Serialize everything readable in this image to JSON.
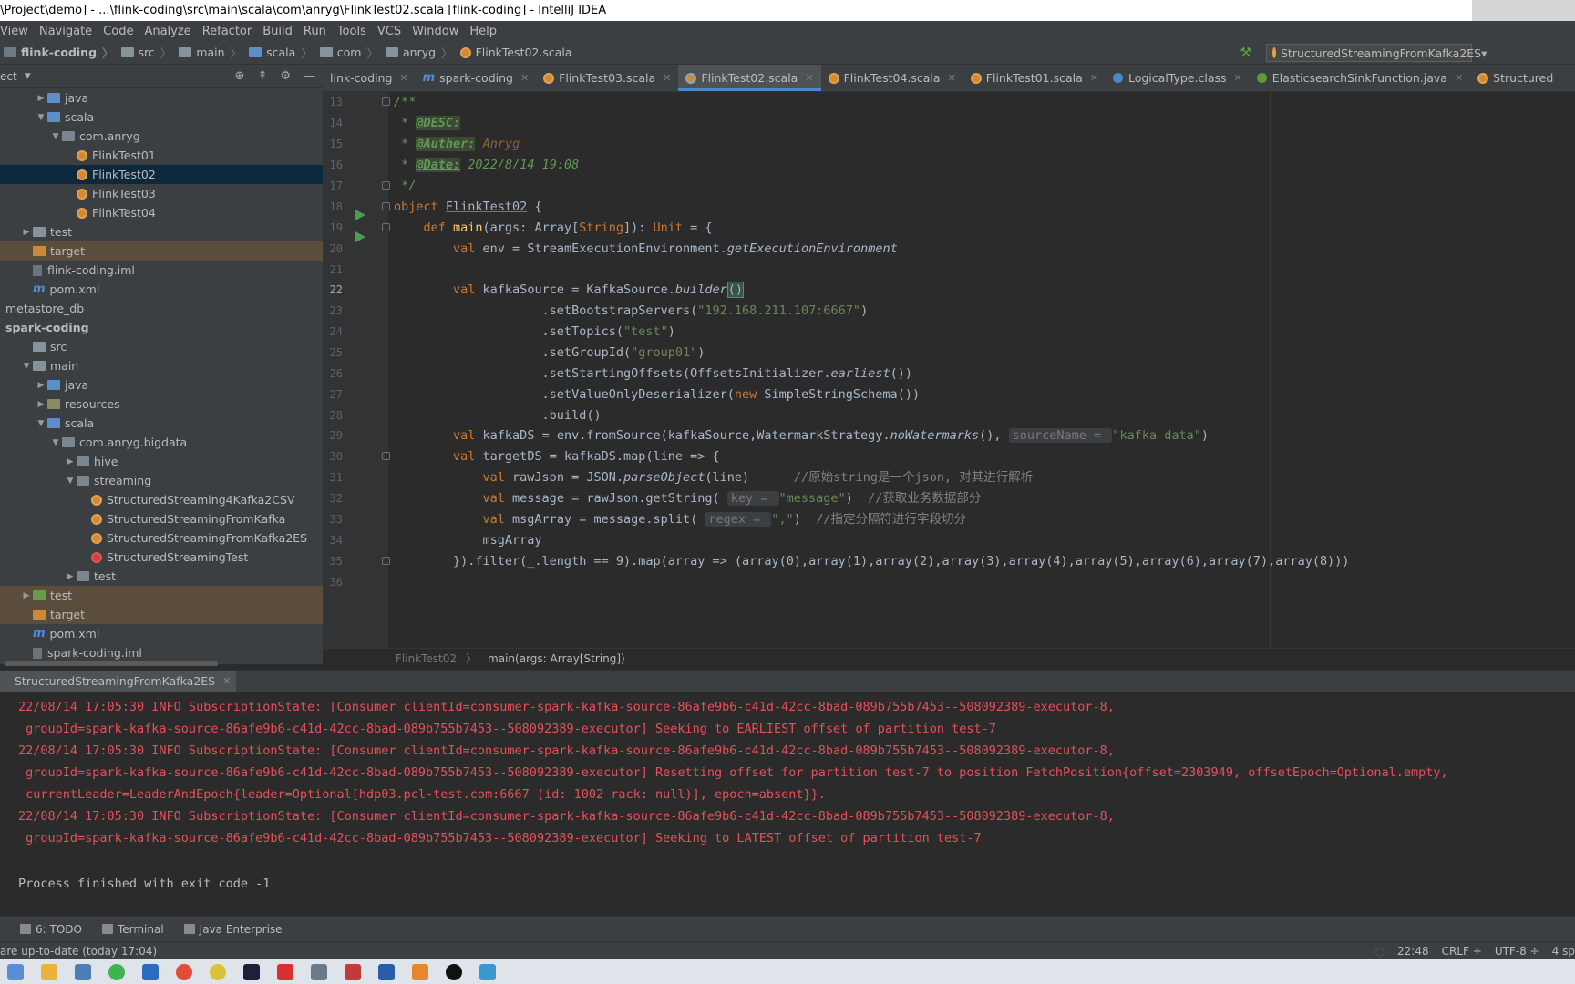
{
  "window": {
    "title": "\\Project\\demo] - ...\\flink-coding\\src\\main\\scala\\com\\anryg\\FlinkTest02.scala [flink-coding] - IntelliJ IDEA"
  },
  "menu": [
    "View",
    "Navigate",
    "Code",
    "Analyze",
    "Refactor",
    "Build",
    "Run",
    "Tools",
    "VCS",
    "Window",
    "Help"
  ],
  "breadcrumb": [
    "flink-coding",
    "src",
    "main",
    "scala",
    "com",
    "anryg",
    "FlinkTest02.scala"
  ],
  "run_config": "StructuredStreamingFromKafka2ES",
  "project_panel": {
    "label": "ect",
    "tree": [
      {
        "label": "java",
        "depth": 1,
        "arrow": "right",
        "icon": "folder-blue"
      },
      {
        "label": "scala",
        "depth": 1,
        "arrow": "down",
        "icon": "folder-blue"
      },
      {
        "label": "com.anryg",
        "depth": 2,
        "arrow": "down",
        "icon": "package"
      },
      {
        "label": "FlinkTest01",
        "depth": 3,
        "icon": "scala-object"
      },
      {
        "label": "FlinkTest02",
        "depth": 3,
        "icon": "scala-object",
        "selected": true
      },
      {
        "label": "FlinkTest03",
        "depth": 3,
        "icon": "scala-object"
      },
      {
        "label": "FlinkTest04",
        "depth": 3,
        "icon": "scala-object"
      },
      {
        "label": "test",
        "depth": 0,
        "arrow": "right",
        "icon": "folder"
      },
      {
        "label": "target",
        "depth": 0,
        "icon": "folder-orange",
        "target": true
      },
      {
        "label": "flink-coding.iml",
        "depth": 0,
        "icon": "iml"
      },
      {
        "label": "pom.xml",
        "depth": 0,
        "icon": "maven"
      },
      {
        "label": "metastore_db",
        "depth": -1,
        "icon": "none"
      },
      {
        "label": "spark-coding",
        "depth": -1,
        "icon": "none",
        "bold": true
      },
      {
        "label": "src",
        "depth": 0,
        "icon": "folder"
      },
      {
        "label": "main",
        "depth": 0,
        "arrow": "down",
        "icon": "folder"
      },
      {
        "label": "java",
        "depth": 1,
        "arrow": "right",
        "icon": "folder-blue"
      },
      {
        "label": "resources",
        "depth": 1,
        "arrow": "right",
        "icon": "folder-res"
      },
      {
        "label": "scala",
        "depth": 1,
        "arrow": "down",
        "icon": "folder-blue"
      },
      {
        "label": "com.anryg.bigdata",
        "depth": 2,
        "arrow": "down",
        "icon": "package"
      },
      {
        "label": "hive",
        "depth": 3,
        "arrow": "right",
        "icon": "package"
      },
      {
        "label": "streaming",
        "depth": 3,
        "arrow": "down",
        "icon": "package"
      },
      {
        "label": "StructuredStreaming4Kafka2CSV",
        "depth": 4,
        "icon": "scala-object"
      },
      {
        "label": "StructuredStreamingFromKafka",
        "depth": 4,
        "icon": "scala-object"
      },
      {
        "label": "StructuredStreamingFromKafka2ES",
        "depth": 4,
        "icon": "scala-object"
      },
      {
        "label": "StructuredStreamingTest",
        "depth": 4,
        "icon": "scala-test"
      },
      {
        "label": "test",
        "depth": 3,
        "arrow": "right",
        "icon": "package"
      },
      {
        "label": "test",
        "depth": 0,
        "arrow": "right",
        "icon": "folder-green",
        "target": true
      },
      {
        "label": "target",
        "depth": 0,
        "icon": "folder-orange",
        "target": true
      },
      {
        "label": "pom.xml",
        "depth": 0,
        "icon": "maven"
      },
      {
        "label": "spark-coding.iml",
        "depth": 0,
        "icon": "iml"
      }
    ]
  },
  "tabs": [
    {
      "label": "link-coding",
      "icon": "none"
    },
    {
      "label": "spark-coding",
      "icon": "maven"
    },
    {
      "label": "FlinkTest03.scala",
      "icon": "scala"
    },
    {
      "label": "FlinkTest02.scala",
      "icon": "scala",
      "active": true
    },
    {
      "label": "FlinkTest04.scala",
      "icon": "scala"
    },
    {
      "label": "FlinkTest01.scala",
      "icon": "scala"
    },
    {
      "label": "LogicalType.class",
      "icon": "class"
    },
    {
      "label": "ElasticsearchSinkFunction.java",
      "icon": "java"
    },
    {
      "label": "Structured",
      "icon": "scala"
    }
  ],
  "editor": {
    "line_numbers": [
      "13",
      "14",
      "15",
      "16",
      "17",
      "18",
      "19",
      "20",
      "21",
      "22",
      "23",
      "24",
      "25",
      "26",
      "27",
      "28",
      "29",
      "30",
      "31",
      "32",
      "33",
      "34",
      "35",
      "36"
    ],
    "tokens": {
      "l13": "/**",
      "l14_star": " * ",
      "l14_tag": "@DESC:",
      "l15_star": " * ",
      "l15_tag": "@Auther:",
      "l15_val": "Anryg",
      "l16_star": " * ",
      "l16_tag": "@Date:",
      "l16_val": " 2022/8/14 19:08",
      "l17": " */",
      "l18_kw": "object ",
      "l18_name": "FlinkTest02",
      "l18_rest": " {",
      "l19_kw": "    def ",
      "l19_name": "main",
      "l19_a": "(args: ",
      "l19_arr": "Array",
      "l19_b": "[",
      "l19_str": "String",
      "l19_c": "]): ",
      "l19_unit": "Unit",
      "l19_d": " = {",
      "l20_kw": "        val ",
      "l20_a": "env = StreamExecutionEnvironment.",
      "l20_i": "getExecutionEnvironment",
      "l22_kw": "        val ",
      "l22_a": "kafkaSource = KafkaSource.",
      "l22_i": "builder",
      "l22_p": "()",
      "l23_a": "                    .setBootstrapServers(",
      "l23_s": "\"192.168.211.107:6667\"",
      "l23_b": ")",
      "l24_a": "                    .setTopics(",
      "l24_s": "\"test\"",
      "l24_b": ")",
      "l25_a": "                    .setGroupId(",
      "l25_s": "\"group01\"",
      "l25_b": ")",
      "l26_a": "                    .setStartingOffsets(OffsetsInitializer.",
      "l26_i": "earliest",
      "l26_b": "())",
      "l27_a": "                    .setValueOnlyDeserializer(",
      "l27_kw": "new ",
      "l27_b": "SimpleStringSchema())",
      "l28_a": "                    .build()",
      "l29_kw": "        val ",
      "l29_a": "kafkaDS = env.fromSource(kafkaSource,WatermarkStrategy.",
      "l29_i": "noWatermarks",
      "l29_b": "(), ",
      "l29_hint": "sourceName = ",
      "l29_s": "\"kafka-data\"",
      "l29_c": ")",
      "l30_kw": "        val ",
      "l30_a": "targetDS = kafkaDS.map(line => {",
      "l31_kw": "            val ",
      "l31_a": "rawJson = JSON.",
      "l31_i": "parseObject",
      "l31_b": "(line)      ",
      "l31_cm": "//原始string是一个json, 对其进行解析",
      "l32_kw": "            val ",
      "l32_a": "message = rawJson.getString( ",
      "l32_hint": "key = ",
      "l32_s": "\"message\"",
      "l32_b": ")  ",
      "l32_cm": "//获取业务数据部分",
      "l33_kw": "            val ",
      "l33_a": "msgArray = message.split( ",
      "l33_hint": "regex = ",
      "l33_s": "\",\"",
      "l33_b": ")  ",
      "l33_cm": "//指定分隔符进行字段切分",
      "l34_a": "            msgArray",
      "l35_a": "        }).filter(_.length == 9).map(array => (array(0),array(1),array(2),array(3),array(4),array(5),array(6),array(7),array(8)))"
    }
  },
  "editor_breadcrumb": {
    "file": "FlinkTest02",
    "method": "main(args: Array[String])"
  },
  "run_panel": {
    "tab": "StructuredStreamingFromKafka2ES",
    "lines": [
      "22/08/14 17:05:30 INFO SubscriptionState: [Consumer clientId=consumer-spark-kafka-source-86afe9b6-c41d-42cc-8bad-089b755b7453--508092389-executor-8,",
      " groupId=spark-kafka-source-86afe9b6-c41d-42cc-8bad-089b755b7453--508092389-executor] Seeking to EARLIEST offset of partition test-7",
      "22/08/14 17:05:30 INFO SubscriptionState: [Consumer clientId=consumer-spark-kafka-source-86afe9b6-c41d-42cc-8bad-089b755b7453--508092389-executor-8,",
      " groupId=spark-kafka-source-86afe9b6-c41d-42cc-8bad-089b755b7453--508092389-executor] Resetting offset for partition test-7 to position FetchPosition{offset=2303949, offsetEpoch=Optional.empty,",
      " currentLeader=LeaderAndEpoch{leader=Optional[hdp03.pcl-test.com:6667 (id: 1002 rack: null)], epoch=absent}}.",
      "22/08/14 17:05:30 INFO SubscriptionState: [Consumer clientId=consumer-spark-kafka-source-86afe9b6-c41d-42cc-8bad-089b755b7453--508092389-executor-8,",
      " groupId=spark-kafka-source-86afe9b6-c41d-42cc-8bad-089b755b7453--508092389-executor] Seeking to LATEST offset of partition test-7"
    ],
    "exit": "Process finished with exit code -1"
  },
  "bottom_tools": [
    {
      "label": "6: TODO"
    },
    {
      "label": "Terminal"
    },
    {
      "label": "Java Enterprise"
    }
  ],
  "status": {
    "left": "are up-to-date (today 17:04)",
    "position": "22:48",
    "line_sep": "CRLF ÷",
    "encoding": "UTF-8 ÷",
    "indent": "4 sp"
  },
  "colors": {
    "accent": "#4a88c7",
    "error_text": "#e6505a",
    "bg": "#2b2b2b",
    "panel": "#3c3f41"
  }
}
